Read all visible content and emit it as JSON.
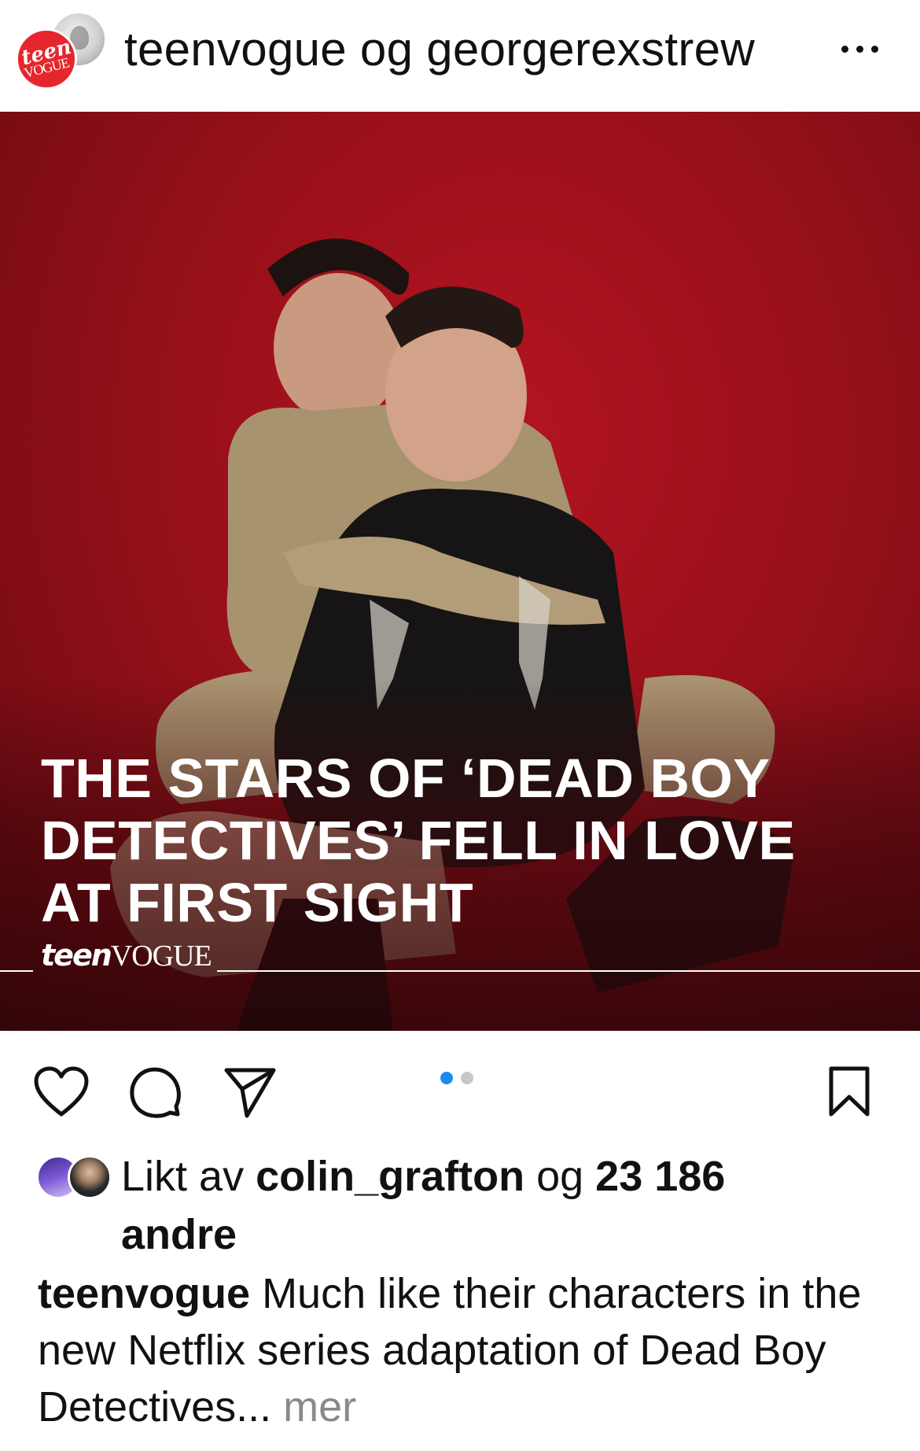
{
  "header": {
    "title": "teenvogue og georgerexstrew",
    "avatar_primary_text": "teen",
    "avatar_primary_text2": "VOGUE",
    "more_icon": "ellipsis-horizontal-icon"
  },
  "post": {
    "headline": "THE STARS OF ‘DEAD BOY\nDETECTIVES’ FELL IN LOVE\nAT FIRST SIGHT",
    "logo_part1": "teen",
    "logo_part2": "VOGUE",
    "background_color": "#a3121c",
    "carousel": {
      "current": 1,
      "total": 2,
      "active_color": "#1a8cf0",
      "inactive_color": "#c7c7c7"
    }
  },
  "actions": {
    "like_icon": "heart-icon",
    "comment_icon": "comment-bubble-icon",
    "share_icon": "paper-plane-icon",
    "save_icon": "bookmark-icon"
  },
  "likes": {
    "prefix": "Likt av ",
    "user": "colin_grafton",
    "connector": " og ",
    "count": "23 186",
    "suffix": "andre"
  },
  "caption": {
    "username": "teenvogue",
    "text": " Much like their characters in the new Netflix series adaptation of Dead Boy Detectives...",
    "more": " mer"
  }
}
